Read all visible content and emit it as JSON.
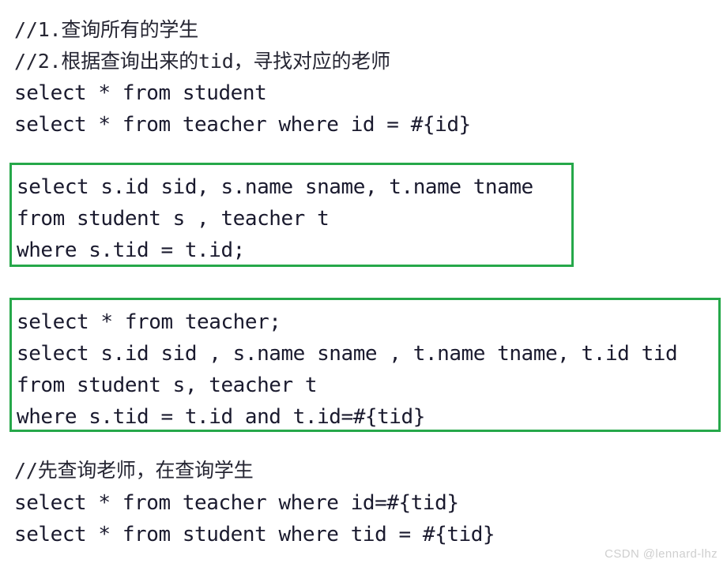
{
  "page": {
    "background_color": "#ffffff",
    "code_text_color": "#1a1a2e",
    "accent_box_color": "#26a84a",
    "watermark_color": "#cfcfcf"
  },
  "top_block": {
    "lines": [
      "//1.查询所有的学生",
      "//2.根据查询出来的tid，寻找对应的老师",
      "select * from student",
      "select * from teacher where id = #{id}"
    ]
  },
  "box_one": {
    "border_color": "#26a84a",
    "lines": [
      "select s.id sid, s.name sname, t.name tname",
      "from student s , teacher t",
      "where s.tid = t.id;"
    ]
  },
  "box_two": {
    "border_color": "#26a84a",
    "lines": [
      "select * from teacher;",
      "select s.id sid , s.name sname , t.name tname, t.id tid",
      "from student s, teacher t",
      "where s.tid = t.id and t.id=#{tid}"
    ]
  },
  "bottom_block": {
    "lines": [
      "//先查询老师，在查询学生",
      "select * from teacher where id=#{tid}",
      "select * from student where tid = #{tid}"
    ]
  },
  "watermark": {
    "text": "CSDN @lennard-lhz"
  }
}
